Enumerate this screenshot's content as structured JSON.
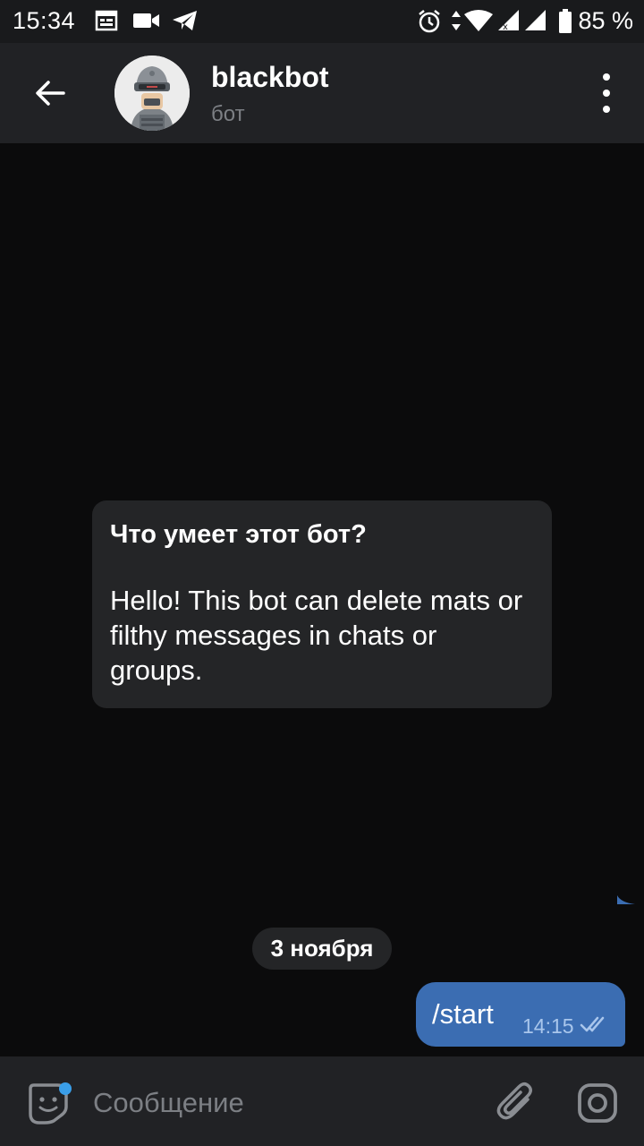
{
  "status_bar": {
    "time": "15:34",
    "battery_text": "85 %",
    "icons": [
      "calendar-icon",
      "video-icon",
      "telegram-icon",
      "alarm-icon",
      "data-arrows-icon",
      "wifi-icon",
      "signal-icon",
      "signal-icon",
      "battery-icon"
    ]
  },
  "header": {
    "title": "blackbot",
    "subtitle": "бот",
    "back_icon": "arrow-left-icon",
    "menu_icon": "more-vertical-icon"
  },
  "bot_info": {
    "title": "Что умеет этот бот?",
    "text": "Hello! This bot can delete mats or filthy messages in chats or groups."
  },
  "date_separator": "3 ноября",
  "messages": [
    {
      "direction": "outgoing",
      "text": "/start",
      "time": "14:15",
      "status": "read"
    }
  ],
  "input_bar": {
    "placeholder": "Сообщение",
    "value": "",
    "sticker_icon": "sticker-icon",
    "attach_icon": "paperclip-icon",
    "camera_icon": "camera-icon"
  },
  "colors": {
    "background": "#0b0b0c",
    "header": "#212225",
    "bubble_out": "#3b6db2",
    "bubble_in": "#242527",
    "badge_dot": "#3a9ee8"
  }
}
